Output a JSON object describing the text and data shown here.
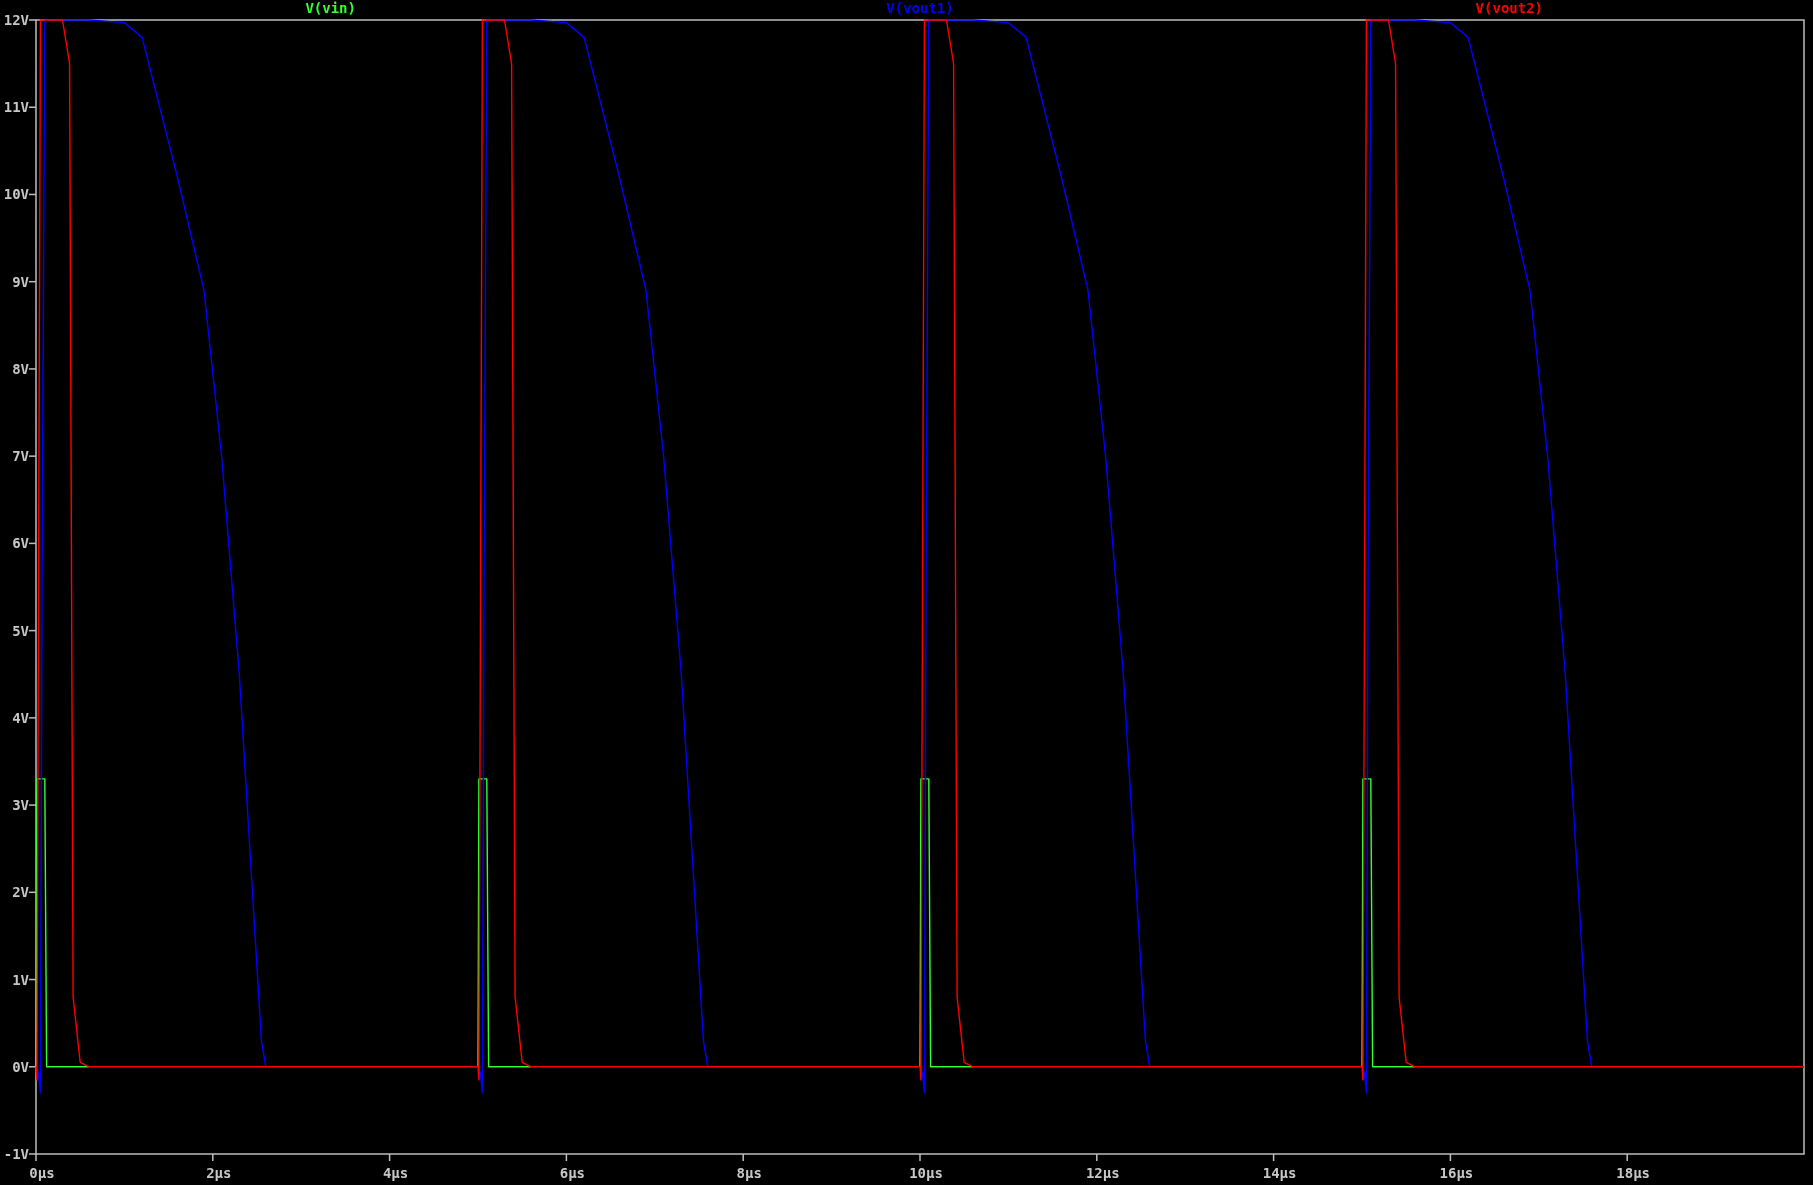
{
  "plot": {
    "chart_data": {
      "type": "line",
      "x": [
        0,
        0.01,
        0.03,
        0.05,
        0.07,
        0.1,
        0.12,
        0.3,
        0.38,
        0.42,
        0.5,
        0.6,
        1,
        1.2,
        1.6,
        1.9,
        2.1,
        2.3,
        2.55,
        2.6,
        5,
        5.01,
        5.03,
        5.05,
        5.07,
        5.1,
        5.12,
        5.3,
        5.38,
        5.42,
        5.5,
        5.6,
        6,
        6.2,
        6.6,
        6.9,
        7.1,
        7.3,
        7.55,
        7.6,
        10,
        10.01,
        10.03,
        10.05,
        10.07,
        10.1,
        10.12,
        10.3,
        10.38,
        10.42,
        10.5,
        10.6,
        11,
        11.2,
        11.6,
        11.9,
        12.1,
        12.3,
        12.55,
        12.6,
        15,
        15.01,
        15.03,
        15.05,
        15.07,
        15.1,
        15.12,
        15.3,
        15.38,
        15.42,
        15.5,
        15.6,
        16,
        16.2,
        16.6,
        16.9,
        17.1,
        17.3,
        17.55,
        17.6,
        20
      ],
      "series": [
        {
          "name": "V(vin)",
          "color": "#33ff33",
          "values": [
            0,
            3.3,
            3.3,
            3.3,
            3.3,
            3.3,
            0,
            0,
            0,
            0,
            0,
            0,
            null,
            null,
            null,
            null,
            null,
            null,
            null,
            null,
            0,
            3.3,
            3.3,
            3.3,
            3.3,
            3.3,
            0,
            0,
            0,
            0,
            0,
            0,
            null,
            null,
            null,
            null,
            null,
            null,
            null,
            null,
            0,
            3.3,
            3.3,
            3.3,
            3.3,
            3.3,
            0,
            0,
            0,
            0,
            0,
            0,
            null,
            null,
            null,
            null,
            null,
            null,
            null,
            null,
            0,
            3.3,
            3.3,
            3.3,
            3.3,
            3.3,
            0,
            0,
            0,
            0,
            0,
            0,
            null,
            null,
            null,
            null,
            null,
            null,
            null,
            null,
            null
          ]
        },
        {
          "name": "V(vout1)",
          "color": "#0000ff",
          "values": [
            0,
            0,
            -0.1,
            -0.3,
            6,
            12,
            12,
            12,
            12,
            12,
            12,
            12,
            11.97,
            11.8,
            10.2,
            8.9,
            7,
            4.5,
            0.3,
            0,
            0,
            0,
            -0.1,
            -0.3,
            6,
            12,
            12,
            12,
            12,
            12,
            12,
            12,
            11.97,
            11.8,
            10.2,
            8.9,
            7,
            4.5,
            0.3,
            0,
            0,
            0,
            -0.1,
            -0.3,
            6,
            12,
            12,
            12,
            12,
            12,
            12,
            12,
            11.97,
            11.8,
            10.2,
            8.9,
            7,
            4.5,
            0.3,
            0,
            0,
            0,
            -0.1,
            -0.3,
            6,
            12,
            12,
            12,
            12,
            12,
            12,
            12,
            11.97,
            11.8,
            10.2,
            8.9,
            7,
            4.5,
            0.3,
            0,
            0
          ]
        },
        {
          "name": "V(vout2)",
          "color": "#ff0000",
          "values": [
            0,
            -0.15,
            6,
            12,
            12,
            12,
            12,
            12,
            11.5,
            0.8,
            0.05,
            0,
            0,
            0,
            0,
            0,
            0,
            0,
            0,
            0,
            0,
            -0.15,
            6,
            12,
            12,
            12,
            12,
            12,
            11.5,
            0.8,
            0.05,
            0,
            0,
            0,
            0,
            0,
            0,
            0,
            0,
            0,
            0,
            -0.15,
            6,
            12,
            12,
            12,
            12,
            12,
            11.5,
            0.8,
            0.05,
            0,
            0,
            0,
            0,
            0,
            0,
            0,
            0,
            0,
            0,
            -0.15,
            6,
            12,
            12,
            12,
            12,
            12,
            11.5,
            0.8,
            0.05,
            0,
            0,
            0,
            0,
            0,
            0,
            0,
            0,
            0,
            0
          ]
        }
      ],
      "xlim": [
        0,
        20
      ],
      "ylim": [
        -1,
        12
      ],
      "xticks": [
        {
          "value": 0,
          "label": "0µs"
        },
        {
          "value": 2,
          "label": "2µs"
        },
        {
          "value": 4,
          "label": "4µs"
        },
        {
          "value": 6,
          "label": "6µs"
        },
        {
          "value": 8,
          "label": "8µs"
        },
        {
          "value": 10,
          "label": "10µs"
        },
        {
          "value": 12,
          "label": "12µs"
        },
        {
          "value": 14,
          "label": "14µs"
        },
        {
          "value": 16,
          "label": "16µs"
        },
        {
          "value": 18,
          "label": "18µs"
        }
      ],
      "yticks": [
        {
          "value": -1,
          "label": "-1V"
        },
        {
          "value": 0,
          "label": "0V"
        },
        {
          "value": 1,
          "label": "1V"
        },
        {
          "value": 2,
          "label": "2V"
        },
        {
          "value": 3,
          "label": "3V"
        },
        {
          "value": 4,
          "label": "4V"
        },
        {
          "value": 5,
          "label": "5V"
        },
        {
          "value": 6,
          "label": "6V"
        },
        {
          "value": 7,
          "label": "7V"
        },
        {
          "value": 8,
          "label": "8V"
        },
        {
          "value": 9,
          "label": "9V"
        },
        {
          "value": 10,
          "label": "10V"
        },
        {
          "value": 11,
          "label": "11V"
        },
        {
          "value": 12,
          "label": "12V"
        }
      ]
    }
  }
}
